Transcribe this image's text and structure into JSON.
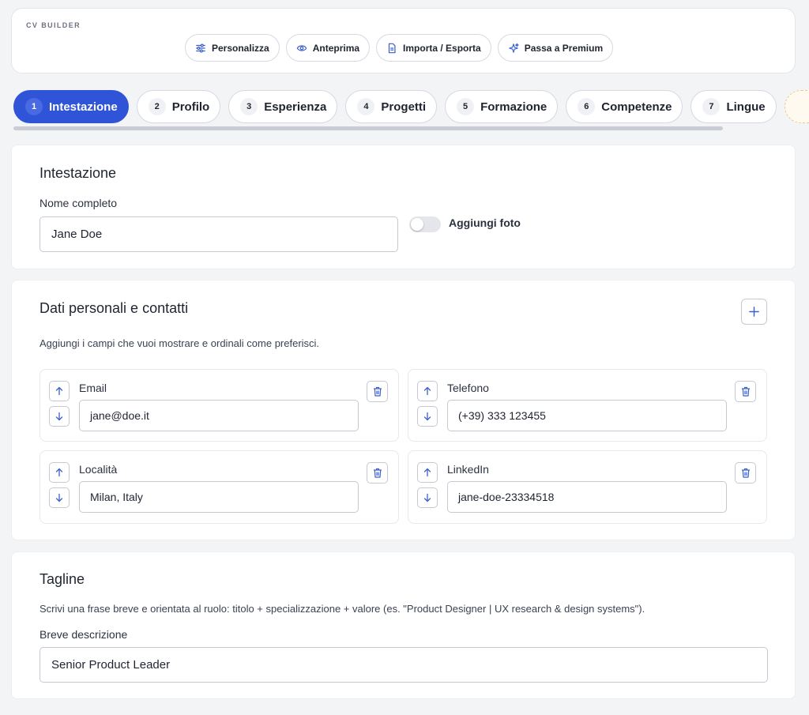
{
  "app": {
    "brand": "CV BUILDER"
  },
  "toolbar": {
    "customize": {
      "label": "Personalizza",
      "icon": "sliders-icon"
    },
    "preview": {
      "label": "Anteprima",
      "icon": "eye-icon"
    },
    "import_export": {
      "label": "Importa / Esporta",
      "icon": "document-icon"
    },
    "premium": {
      "label": "Passa a Premium",
      "icon": "sparkle-icon"
    }
  },
  "steps": [
    {
      "num": "1",
      "label": "Intestazione",
      "active": true
    },
    {
      "num": "2",
      "label": "Profilo"
    },
    {
      "num": "3",
      "label": "Esperienza"
    },
    {
      "num": "4",
      "label": "Progetti"
    },
    {
      "num": "5",
      "label": "Formazione"
    },
    {
      "num": "6",
      "label": "Competenze"
    },
    {
      "num": "7",
      "label": "Lingue"
    }
  ],
  "header_section": {
    "title": "Intestazione",
    "name_label": "Nome completo",
    "name_value": "Jane Doe",
    "photo_toggle_label": "Aggiungi foto",
    "photo_toggle_on": false
  },
  "contacts_section": {
    "title": "Dati personali e contatti",
    "hint": "Aggiungi i campi che vuoi mostrare e ordinali come preferisci.",
    "fields": [
      {
        "label": "Email",
        "value": "jane@doe.it"
      },
      {
        "label": "Telefono",
        "value": "(+39) 333 123455"
      },
      {
        "label": "Località",
        "value": "Milan, Italy"
      },
      {
        "label": "LinkedIn",
        "value": "jane-doe-23334518"
      }
    ]
  },
  "tagline_section": {
    "title": "Tagline",
    "hint": "Scrivi una frase breve e orientata al ruolo: titolo + specializzazione + valore (es. \"Product Designer | UX research & design systems\").",
    "desc_label": "Breve descrizione",
    "desc_value": "Senior Product Leader"
  },
  "colors": {
    "accent": "#2f54d8",
    "icon": "#3a5fcc",
    "background": "#f3f4f6"
  }
}
